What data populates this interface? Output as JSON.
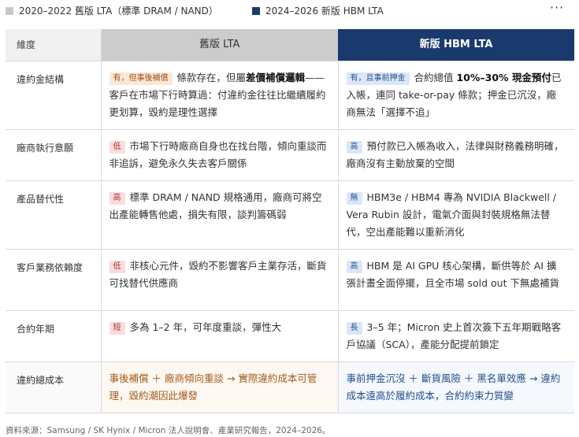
{
  "legend": {
    "old": {
      "label": "2020–2022 舊版 LTA（標準 DRAM / NAND）",
      "color": "#c8c8c8"
    },
    "new": {
      "label": "2024–2026 新版 HBM LTA",
      "color": "#1a3a6d"
    },
    "more": "···"
  },
  "table": {
    "headers": {
      "dimension": "維度",
      "old": "舊版 LTA",
      "new": "新版 HBM LTA"
    },
    "rows": [
      {
        "dimension": "違約金結構",
        "old": {
          "badge": "有，但事後補償",
          "pre": "條款存在，但屬",
          "bold": "差價補償邏輯",
          "post": "——客戶在市場下行時算過：付違約金往往比繼續履約更划算，毀約是理性選擇"
        },
        "new": {
          "badge": "有，且事前押金",
          "pre": "合約總值 ",
          "bold": "10%–30% 現金預付",
          "post": "已入帳，連同 take-or-pay 條款；押金已沉沒，廠商無法「選擇不追」"
        }
      },
      {
        "dimension": "廠商執行意願",
        "old": {
          "badge": "低",
          "text": "市場下行時廠商自身也在找台階，傾向重談而非追訴，避免永久失去客戶關係"
        },
        "new": {
          "badge": "高",
          "text": "預付款已入帳為收入，法律與財務義務明確，廠商沒有主動放棄的空間"
        }
      },
      {
        "dimension": "產品替代性",
        "old": {
          "badge": "高",
          "text": "標準 DRAM / NAND 規格通用，廠商可將空出產能轉售他處，損失有限，談判籌碼弱"
        },
        "new": {
          "badge": "無",
          "text": "HBM3e / HBM4 專為 NVIDIA Blackwell / Vera Rubin 設計，電氣介面與封裝規格無法替代，空出產能難以重新消化"
        }
      },
      {
        "dimension": "客戶業務依賴度",
        "old": {
          "badge": "低",
          "text": "非核心元件，毀約不影響客戶主業存活，斷貨可找替代供應商"
        },
        "new": {
          "badge": "高",
          "text": "HBM 是 AI GPU 核心架構，斷供等於 AI 擴張計畫全面停擺，且全市場 sold out 下無處補貨"
        }
      },
      {
        "dimension": "合約年期",
        "old": {
          "badge": "短",
          "text": "多為 1–2 年，可年度重談，彈性大"
        },
        "new": {
          "badge": "長",
          "text": "3–5 年；Micron 史上首次簽下五年期戰略客戶協議（SCA），產能分配提前鎖定"
        }
      },
      {
        "dimension": "違約總成本",
        "old": {
          "text": "事後補償 ＋ 廠商傾向重談 → 實際違約成本可管理，毀約潮因此爆發"
        },
        "new": {
          "text": "事前押金沉沒 ＋ 斷貨風險 ＋ 黑名單效應 → 違約成本遠高於履約成本，合約約束力質變"
        }
      }
    ]
  },
  "source": "資料來源：Samsung / SK Hynix / Micron 法人說明會、產業研究報告，2024–2026。"
}
